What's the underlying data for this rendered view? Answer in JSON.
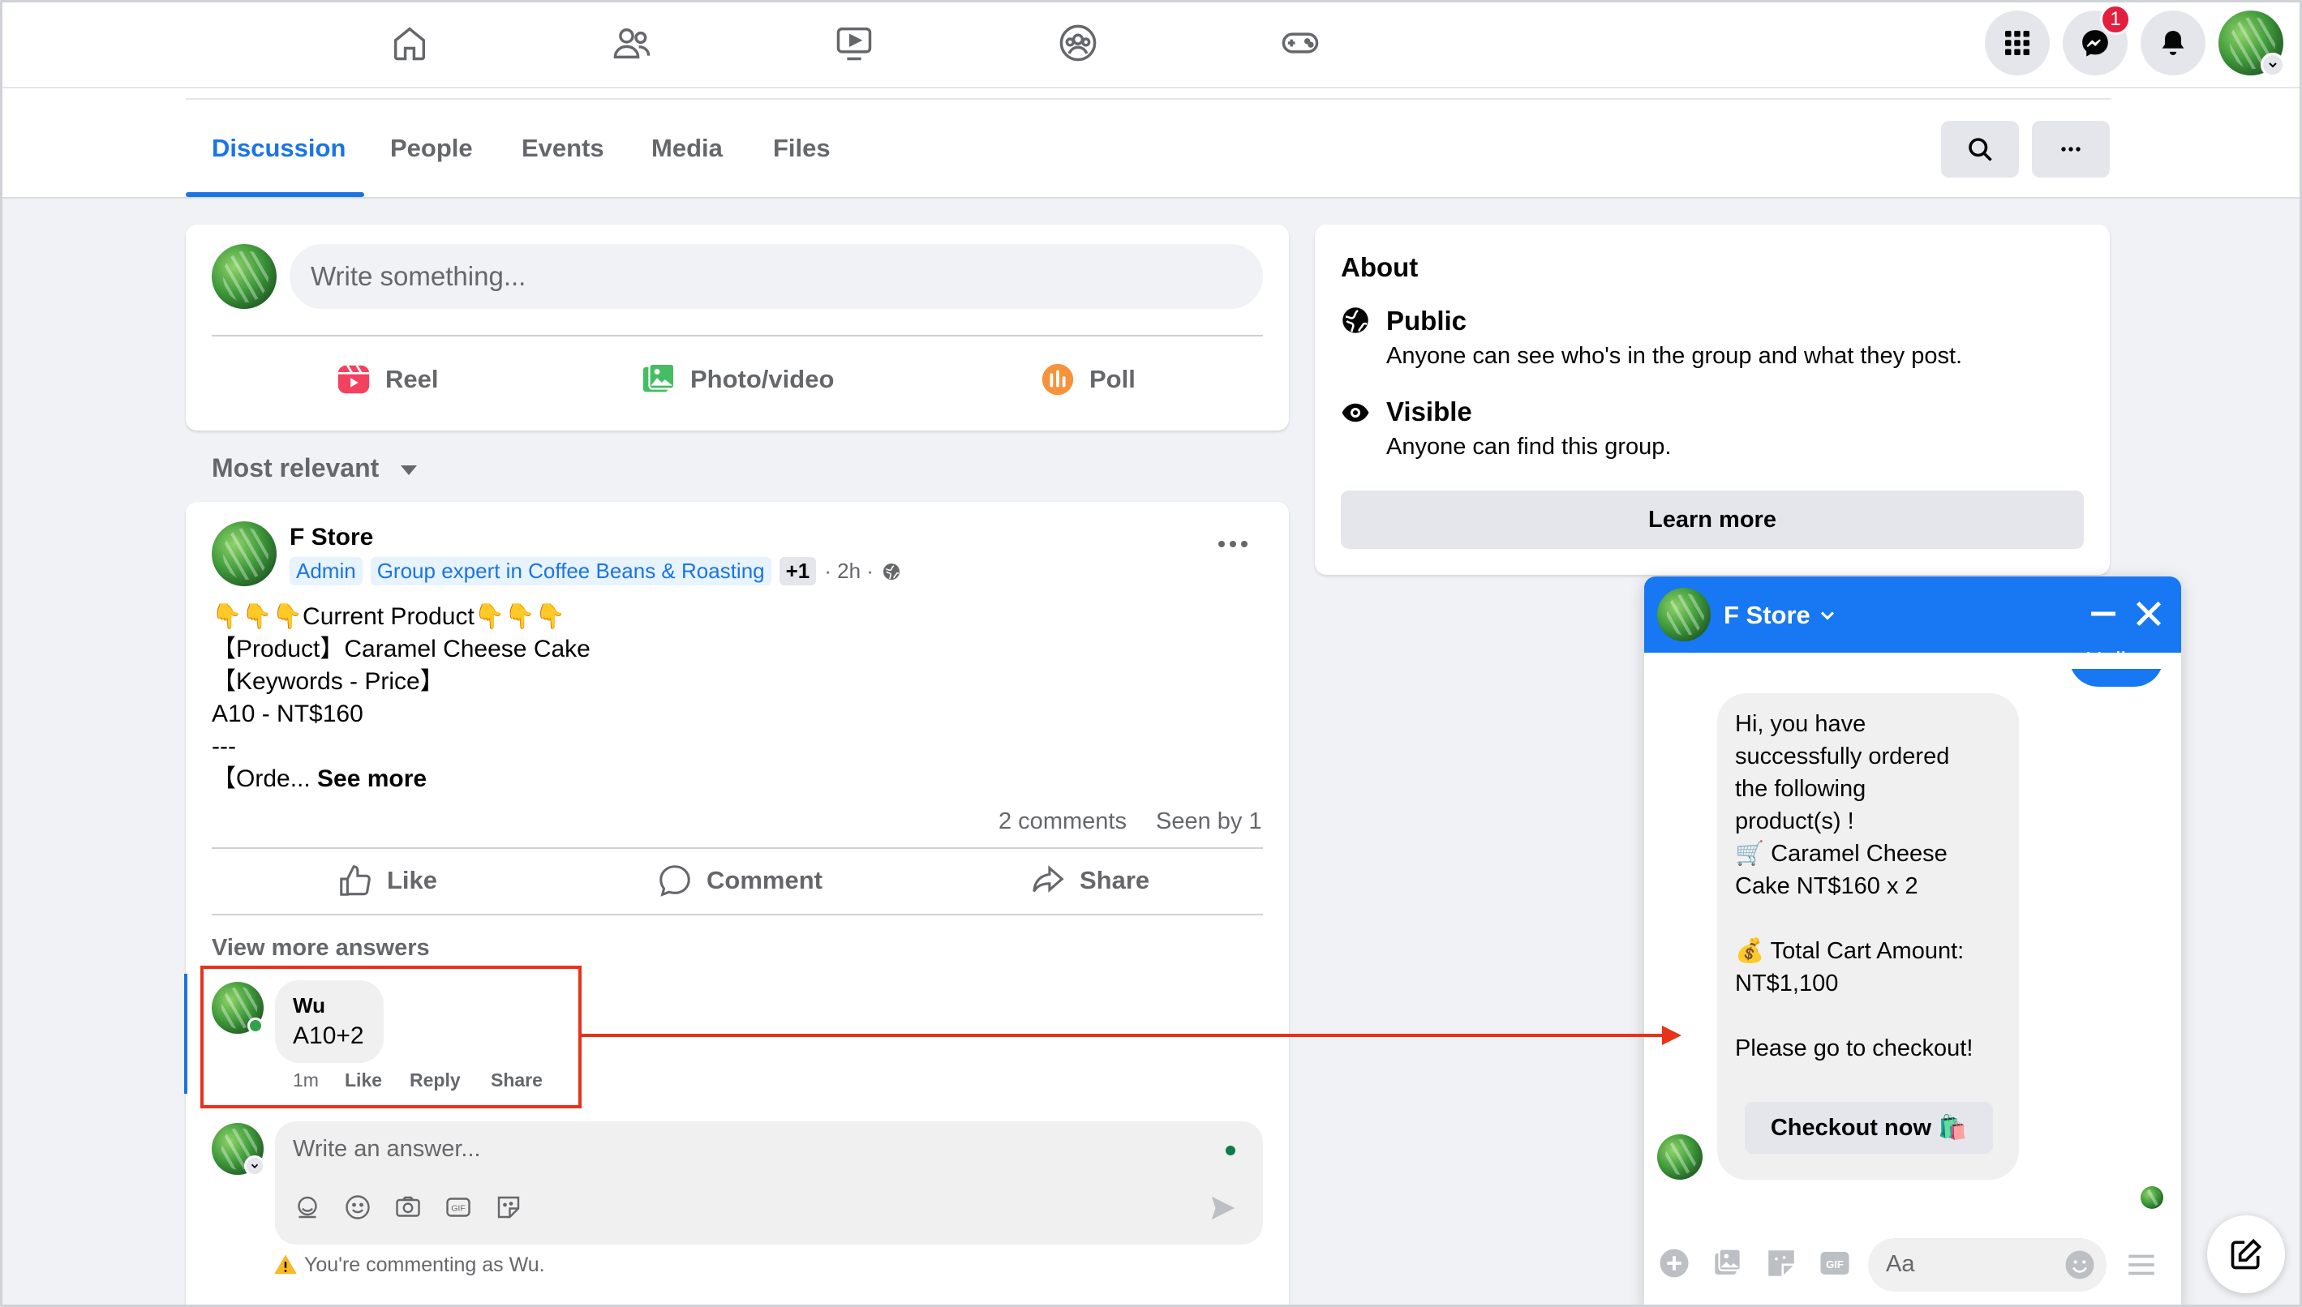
{
  "nav": {
    "icons": [
      "home-icon",
      "friends-icon",
      "watch-icon",
      "groups-icon",
      "gaming-icon"
    ],
    "messenger_badge": "1"
  },
  "tabs": {
    "discussion": "Discussion",
    "people": "People",
    "events": "Events",
    "media": "Media",
    "files": "Files"
  },
  "composer": {
    "placeholder": "Write something...",
    "reel": "Reel",
    "photo_video": "Photo/video",
    "poll": "Poll"
  },
  "sort_label": "Most relevant",
  "post": {
    "author": "F Store",
    "admin_chip": "Admin",
    "expert_chip": "Group expert in Coffee Beans & Roasting",
    "plus_chip": "+1",
    "time": "· 2h ·",
    "lines": [
      "👇👇👇Current Product👇👇👇",
      "【Product】Caramel Cheese Cake",
      "【Keywords - Price】",
      "A10 - NT$160",
      "---"
    ],
    "last_line_prefix": "【Orde... ",
    "see_more": "See more",
    "comments_count": "2 comments",
    "seen_by": "Seen by 1",
    "like": "Like",
    "comment": "Comment",
    "share": "Share",
    "view_more": "View more answers"
  },
  "comment": {
    "author": "Wu",
    "text": "A10+2",
    "time": "1m",
    "like": "Like",
    "reply": "Reply",
    "share": "Share"
  },
  "answer": {
    "placeholder": "Write an answer...",
    "warning": "You're commenting as Wu."
  },
  "about": {
    "title": "About",
    "public_title": "Public",
    "public_desc": "Anyone can see who's in the group and what they post.",
    "visible_title": "Visible",
    "visible_desc": "Anyone can find this group.",
    "learn_more": "Learn more"
  },
  "chat": {
    "name": "F Store",
    "hello": "Hello",
    "message_lines": [
      "Hi, you have",
      "successfully ordered",
      "the following",
      "product(s) !",
      "🛒 Caramel Cheese",
      "Cake NT$160 x 2",
      "",
      "💰 Total Cart Amount:",
      "NT$1,100",
      "",
      "Please go to checkout!"
    ],
    "checkout_button": "Checkout now 🛍️",
    "input_placeholder": "Aa"
  },
  "colors": {
    "accent": "#1b74e4",
    "chat_header": "#1877f2",
    "annotation": "#e8321b"
  }
}
